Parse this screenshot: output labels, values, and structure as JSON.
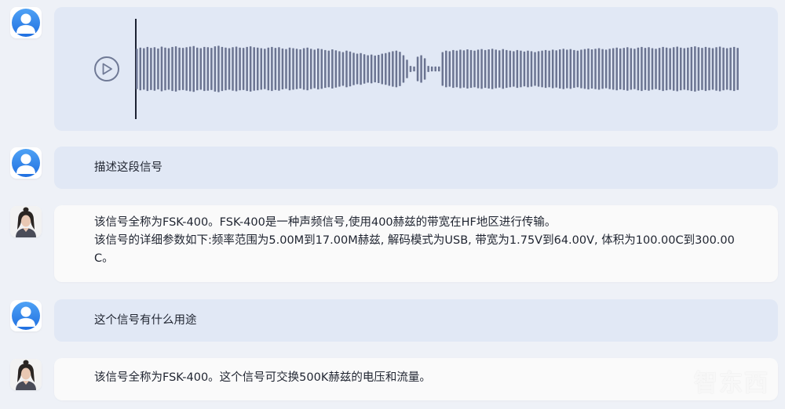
{
  "messages": [
    {
      "role": "user",
      "type": "audio"
    },
    {
      "role": "user",
      "type": "text",
      "lines": [
        "描述这段信号"
      ]
    },
    {
      "role": "assistant",
      "type": "text",
      "lines": [
        "该信号全称为FSK-400。FSK-400是一种声频信号,使用400赫兹的带宽在HF地区进行传输。",
        "该信号的详细参数如下:频率范围为5.00M到17.00M赫兹, 解码模式为USB, 带宽为1.75V到64.00V, 体积为100.00C到300.00C。"
      ]
    },
    {
      "role": "user",
      "type": "text",
      "lines": [
        "这个信号有什么用途"
      ]
    },
    {
      "role": "assistant",
      "type": "text",
      "lines": [
        "该信号全称为FSK-400。这个信号可交换500K赫兹的电压和流量。"
      ]
    }
  ],
  "audio": {
    "waveform_color": "#6b7491",
    "levels": [
      0.66,
      0.7,
      0.68,
      0.72,
      0.69,
      0.71,
      0.67,
      0.73,
      0.7,
      0.68,
      0.72,
      0.74,
      0.7,
      0.69,
      0.71,
      0.73,
      0.75,
      0.7,
      0.68,
      0.72,
      0.71,
      0.69,
      0.74,
      0.76,
      0.72,
      0.7,
      0.68,
      0.71,
      0.73,
      0.7,
      0.69,
      0.72,
      0.74,
      0.71,
      0.7,
      0.68,
      0.66,
      0.7,
      0.72,
      0.69,
      0.71,
      0.67,
      0.65,
      0.7,
      0.68,
      0.66,
      0.64,
      0.68,
      0.7,
      0.66,
      0.63,
      0.67,
      0.65,
      0.62,
      0.6,
      0.64,
      0.61,
      0.58,
      0.55,
      0.6,
      0.57,
      0.53,
      0.5,
      0.52,
      0.48,
      0.45,
      0.47,
      0.44,
      0.46,
      0.5,
      0.52,
      0.55,
      0.58,
      0.6,
      0.56,
      0.45,
      0.3,
      0.1,
      0.08,
      0.4,
      0.45,
      0.35,
      0.1,
      0.08,
      0.08,
      0.08,
      0.55,
      0.6,
      0.58,
      0.62,
      0.6,
      0.63,
      0.61,
      0.64,
      0.62,
      0.6,
      0.63,
      0.65,
      0.62,
      0.64,
      0.66,
      0.63,
      0.61,
      0.65,
      0.62,
      0.6,
      0.58,
      0.62,
      0.6,
      0.57,
      0.6,
      0.58,
      0.55,
      0.58,
      0.6,
      0.62,
      0.6,
      0.63,
      0.61,
      0.64,
      0.66,
      0.63,
      0.65,
      0.62,
      0.6,
      0.63,
      0.65,
      0.67,
      0.64,
      0.66,
      0.68,
      0.65,
      0.63,
      0.66,
      0.68,
      0.7,
      0.67,
      0.69,
      0.71,
      0.68,
      0.66,
      0.7,
      0.72,
      0.69,
      0.71,
      0.68,
      0.66,
      0.69,
      0.72,
      0.7,
      0.68,
      0.71,
      0.73,
      0.7,
      0.68,
      0.7,
      0.72,
      0.74,
      0.71,
      0.69,
      0.72,
      0.7,
      0.68,
      0.71,
      0.73,
      0.7,
      0.68,
      0.7,
      0.72,
      0.69
    ]
  },
  "watermark": "智东西"
}
